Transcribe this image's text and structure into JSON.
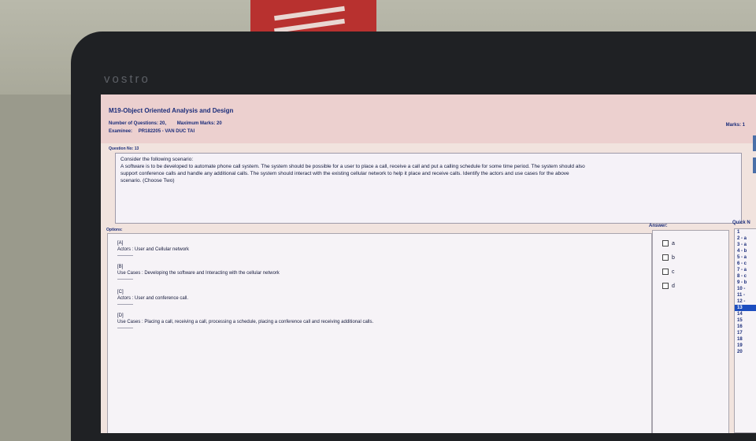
{
  "device": {
    "brand": "vostro"
  },
  "header": {
    "course": "M19-Object Oriented Analysis and Design",
    "num_questions_label": "Number of Questions: 20,",
    "max_marks_label": "Maximum Marks: 20",
    "examinee_label": "Examinee:",
    "examinee_value": "PR182205 - VAN DUC TAI",
    "marks": "Marks: 1"
  },
  "question": {
    "label": "Question No: 13",
    "lines": [
      "Consider the following scenario:",
      "A software is to be developed to automate phone call system. The system should be possible for a user to place a call, receive a call and put a calling schedule for some time period. The system should also",
      "support conference calls and handle any additional calls. The system should interact with the existing cellular network to help it place and receive calls. Identify the actors and use cases for the above",
      "scenario. (Choose Two)"
    ]
  },
  "options": {
    "label": "Options:",
    "items": [
      {
        "key": "[A]",
        "text": "Actors : User and Cellular network",
        "sep": "----------"
      },
      {
        "key": "[B]",
        "text": "Use Cases : Developing the software and Interacting with the cellular network",
        "sep": "----------"
      },
      {
        "key": "[C]",
        "text": "Actors : User and conference call.",
        "sep": "----------"
      },
      {
        "key": "[D]",
        "text": "Use Cases : Placing a call, receiving a call, processing a schedule, placing a conference call and receiving additional calls.",
        "sep": "----------"
      }
    ]
  },
  "answer": {
    "label": "Answer:",
    "choices": [
      "a",
      "b",
      "c",
      "d"
    ]
  },
  "quick": {
    "label": "Quick N",
    "items": [
      "1",
      "2 - a",
      "3 - a",
      "4 - b",
      "5 - a",
      "6 - c",
      "7 - a",
      "8 - c",
      "9 - b",
      "10 -",
      "11 -",
      "12 -",
      "13",
      "14",
      "15",
      "16",
      "17",
      "18",
      "19",
      "20"
    ],
    "selected": "13"
  }
}
